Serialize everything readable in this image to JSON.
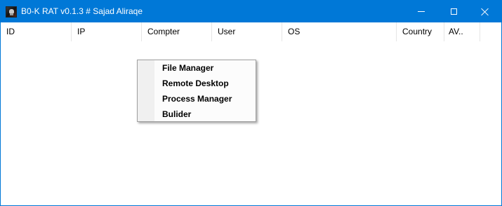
{
  "window": {
    "title": "B0-K RAT v0.1.3 # Sajad Aliraqe",
    "icon": "skull-app-icon",
    "controls": {
      "minimize_icon": "minimize-icon",
      "maximize_icon": "maximize-icon",
      "close_icon": "close-icon"
    },
    "accent_color": "#0078d7"
  },
  "listview": {
    "columns": [
      "ID",
      "IP",
      "Compter",
      "User",
      "OS",
      "Country",
      "AV.."
    ],
    "rows": []
  },
  "context_menu": {
    "items": [
      "File Manager",
      "Remote Desktop",
      "Process Manager",
      "Bulider"
    ]
  }
}
